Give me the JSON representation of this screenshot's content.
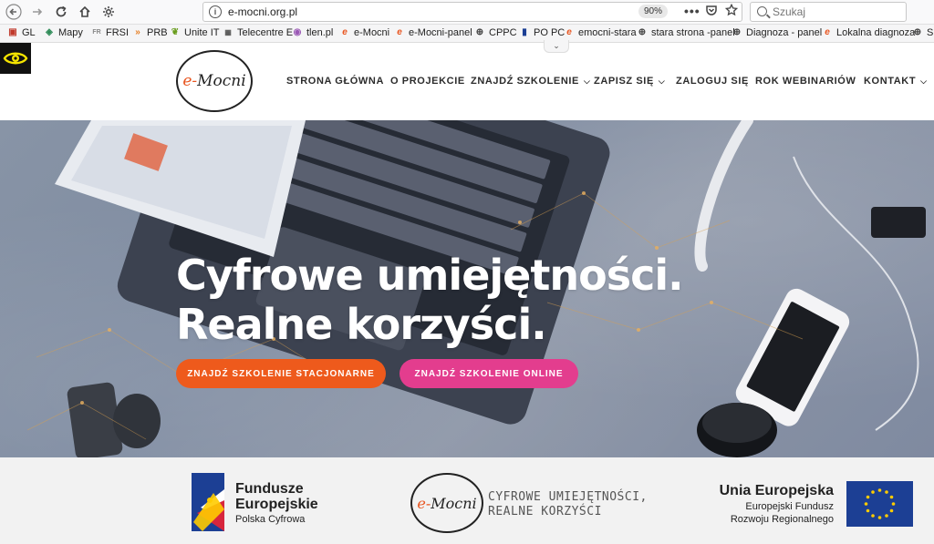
{
  "browser": {
    "url": "e-mocni.org.pl",
    "zoom": "90%",
    "search_placeholder": "Szukaj",
    "bookmarks": [
      {
        "label": "GL",
        "icon": "gl-icon"
      },
      {
        "label": "Mapy",
        "icon": "map-icon"
      },
      {
        "label": "FRSI",
        "icon": "frsi-icon"
      },
      {
        "label": "PRB",
        "icon": "chevrons-icon"
      },
      {
        "label": "Unite IT",
        "icon": "unite-icon"
      },
      {
        "label": "Telecentre E",
        "icon": "telecentre-icon"
      },
      {
        "label": "tlen.pl",
        "icon": "tlen-icon"
      },
      {
        "label": "e-Mocni",
        "icon": "emocni-icon"
      },
      {
        "label": "e-Mocni-panel",
        "icon": "emocni-icon"
      },
      {
        "label": "CPPC",
        "icon": "globe-icon"
      },
      {
        "label": "PO PC",
        "icon": "popc-icon"
      },
      {
        "label": "emocni-stara",
        "icon": "emocni-icon"
      },
      {
        "label": "stara strona -panel",
        "icon": "globe-icon"
      },
      {
        "label": "Diagnoza - panel",
        "icon": "globe-icon"
      },
      {
        "label": "Lokalna diagnoza",
        "icon": "emocni-icon"
      },
      {
        "label": "SL",
        "icon": "globe-icon"
      }
    ]
  },
  "site": {
    "logo_e": "e-",
    "logo_text": "Mocni",
    "menu": [
      {
        "label": "STRONA GŁÓWNA",
        "dropdown": false
      },
      {
        "label": "O PROJEKCIE",
        "dropdown": false
      },
      {
        "label": "ZNAJDŹ SZKOLENIE",
        "dropdown": true
      },
      {
        "label": "ZAPISZ SIĘ",
        "dropdown": true
      },
      {
        "label": "ZALOGUJ SIĘ",
        "dropdown": false
      },
      {
        "label": "ROK WEBINARIÓW",
        "dropdown": false
      },
      {
        "label": "KONTAKT",
        "dropdown": true
      }
    ]
  },
  "hero": {
    "title_line1": "Cyfrowe umiejętności.",
    "title_line2": "Realne korzyści.",
    "cta_stationary": "ZNAJDŹ SZKOLENIE STACJONARNE",
    "cta_online": "ZNAJDŹ SZKOLENIE ONLINE"
  },
  "footer": {
    "fe_line1": "Fundusze",
    "fe_line2": "Europejskie",
    "fe_line3": "Polska Cyfrowa",
    "tagline_line1": "CYFROWE UMIEJĘTNOŚCI,",
    "tagline_line2": "REALNE KORZYŚCI",
    "ue_line1": "Unia Europejska",
    "ue_line2": "Europejski Fundusz",
    "ue_line3": "Rozwoju Regionalnego"
  },
  "colors": {
    "accent_orange": "#ee5a1c",
    "accent_pink": "#e33d8e",
    "eu_blue": "#1c3f94",
    "eu_yellow": "#ffcc00"
  }
}
